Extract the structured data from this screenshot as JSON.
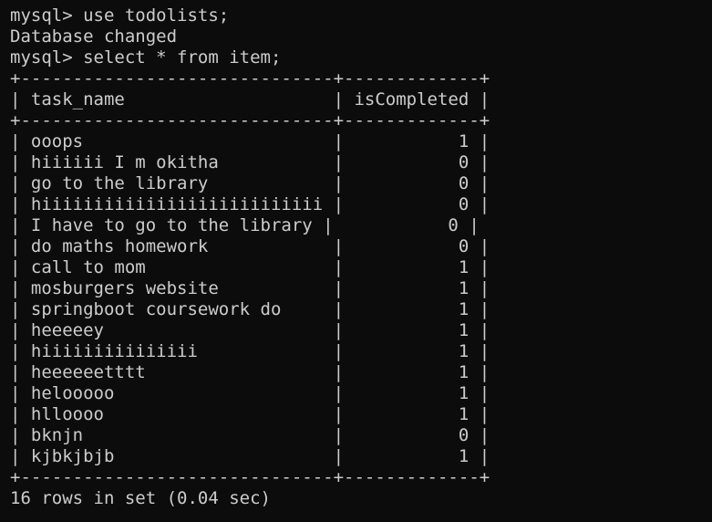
{
  "terminal": {
    "lines": [
      "mysql> use todolists;",
      "Database changed",
      "mysql> select * from item;",
      "+------------------------------+-------------+",
      "| task_name                    | isCompleted |",
      "+------------------------------+-------------+",
      "| ooops                        |           1 |",
      "| hiiiiii I m okitha           |           0 |",
      "| go to the library            |           0 |",
      "| hiiiiiiiiiiiiiiiiiiiiiiiiiii |           0 |",
      "| I have to go to the library |           0 |",
      "| do maths homework            |           0 |",
      "| call to mom                  |           1 |",
      "| mosburgers website           |           1 |",
      "| springboot coursework do     |           1 |",
      "| heeeeey                      |           1 |",
      "| hiiiiiiiiiiiiiii             |           1 |",
      "| heeeeeetttt                  |           1 |",
      "| helooooo                     |           1 |",
      "| hlloooo                      |           1 |",
      "| bknjn                        |           0 |",
      "| kjbkjbjb                     |           1 |",
      "+------------------------------+-------------+",
      "16 rows in set (0.04 sec)"
    ]
  },
  "colors": {
    "background": "#0c0c0c",
    "foreground": "#cccccc"
  }
}
